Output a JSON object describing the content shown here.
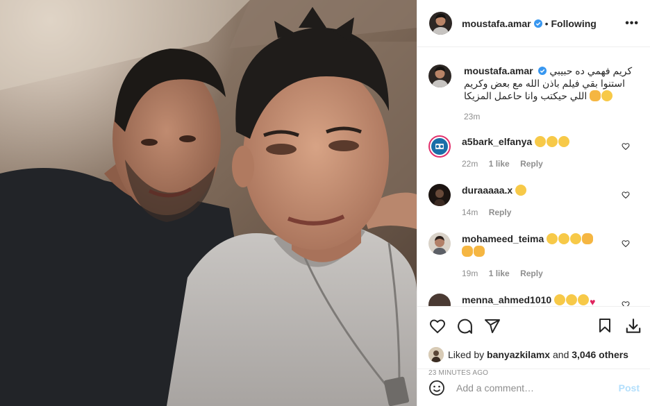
{
  "header": {
    "username": "moustafa.amar",
    "separator": "•",
    "follow_label": "Following",
    "more_label": "•••"
  },
  "caption": {
    "username": "moustafa.amar",
    "text": "كريم فهمي ده حبيبي استنوا بقي فيلم باذن الله مع بعض وكريم اللي حيكتب وانا حاعمل المزيكا",
    "time": "23m"
  },
  "comments": [
    {
      "username": "a5bark_elfanya",
      "time": "22m",
      "likes": "1 like",
      "reply": "Reply"
    },
    {
      "username": "duraaaaa.x",
      "time": "14m",
      "reply": "Reply"
    },
    {
      "username": "mohameed_teima",
      "time": "19m",
      "likes": "1 like",
      "reply": "Reply"
    },
    {
      "username": "menna_ahmed1010"
    }
  ],
  "likes": {
    "prefix": "Liked by",
    "user": "banyazkilamx",
    "middle": "and",
    "others": "3,046 others"
  },
  "timestamp": "23 MINUTES AGO",
  "add_comment": {
    "placeholder": "Add a comment…",
    "post_label": "Post"
  },
  "colors": {
    "verified": "#3897f0",
    "post_disabled": "#b2dffc",
    "muted": "#8e8e8e"
  }
}
